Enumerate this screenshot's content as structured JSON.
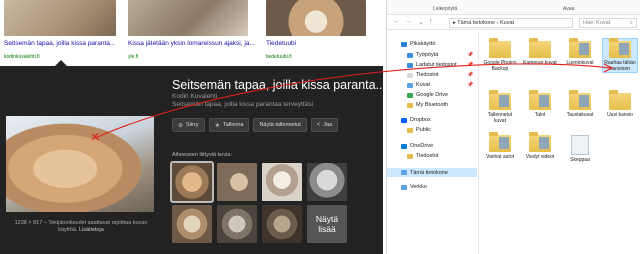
{
  "results": [
    {
      "title": "Seitsemän tapaa, joilla kissa paranta...",
      "source": "kodinkuvalehti.fi"
    },
    {
      "title": "Kissa jätetään yksin lomareissun ajaksi, ja...",
      "source": "yle.fi"
    },
    {
      "title": "Tiedetuubi",
      "source": "tiedetuubi.fi"
    }
  ],
  "panel": {
    "title": "Seitsemän tapaa, joilla kissa paranta...",
    "source": "Kodin Kuvalehti",
    "description": "Seitsemän tapaa, joilla kissa parantaa terveyttäsi",
    "buttons": [
      {
        "label": "Siirry",
        "icon": "open-icon"
      },
      {
        "label": "Tallenna",
        "icon": "star-icon"
      },
      {
        "label": "Näytä tallennetut"
      },
      {
        "label": "Jaa",
        "icon": "share-icon"
      }
    ],
    "related_label": "Aiheeseen liittyviä kuvia:",
    "show_more": "Näytä lisää",
    "dimensions": "1238 × 817",
    "copyright": "Tekijänoikeudet saattavat rajoittaa kuvan käyttöä.",
    "copyright_link": "Lisätietoja"
  },
  "explorer": {
    "ribbon": {
      "clipboard": "Leikepöytä",
      "open": "Avaa"
    },
    "breadcrumb": [
      "Tämä tietokone",
      "Kuvat"
    ],
    "search_placeholder": "Hae: Kuvat",
    "nav": [
      {
        "label": "Pikakäyttö",
        "icon": "star-icon",
        "color": "#2b7cd3"
      },
      {
        "label": "Työpöytä",
        "icon": "desktop-icon",
        "color": "#3c8dde",
        "pinned": true
      },
      {
        "label": "Ladatut tiedostot",
        "icon": "download-icon",
        "color": "#3c8dde",
        "pinned": true
      },
      {
        "label": "Tiedostot",
        "icon": "documents-icon",
        "color": "#d9d9d9",
        "pinned": true
      },
      {
        "label": "Kuvat",
        "icon": "pictures-icon",
        "color": "#5aa3e6",
        "pinned": true
      },
      {
        "label": "Google Drive",
        "icon": "drive-icon",
        "color": "#34a853"
      },
      {
        "label": "My Bluetooth",
        "icon": "folder-icon",
        "color": "#e6bd4a"
      },
      {
        "label": "Dropbox",
        "icon": "dropbox-icon",
        "color": "#0061fe"
      },
      {
        "label": "Public",
        "icon": "folder-icon",
        "color": "#e6bd4a"
      },
      {
        "label": "OneDrive",
        "icon": "onedrive-icon",
        "color": "#0078d4"
      },
      {
        "label": "Tiedostot",
        "icon": "folder-icon",
        "color": "#e6bd4a"
      },
      {
        "label": "Tämä tietokone",
        "icon": "computer-icon",
        "color": "#5aa3e6"
      },
      {
        "label": "Verkko",
        "icon": "network-icon",
        "color": "#5aa3e6"
      }
    ],
    "items": [
      {
        "label": "Google Photos Backup",
        "type": "folder"
      },
      {
        "label": "Kameran kuvat",
        "type": "folder"
      },
      {
        "label": "Luontokuvat",
        "type": "folder"
      },
      {
        "label": "Raahaa tähän kansioon",
        "type": "folder",
        "selected": true
      },
      {
        "label": "Tallennetut kuvat",
        "type": "folder"
      },
      {
        "label": "Talot",
        "type": "folder"
      },
      {
        "label": "Taustakuvat",
        "type": "folder"
      },
      {
        "label": "Uusi kansio",
        "type": "folder"
      },
      {
        "label": "Vanhat autot",
        "type": "folder"
      },
      {
        "label": "Viedyt videot",
        "type": "folder"
      },
      {
        "label": "Skeppaa",
        "type": "file"
      }
    ]
  },
  "colors": {
    "annotation": "#e0201c",
    "selection": "#cce8ff",
    "link": "#1a0dab"
  }
}
